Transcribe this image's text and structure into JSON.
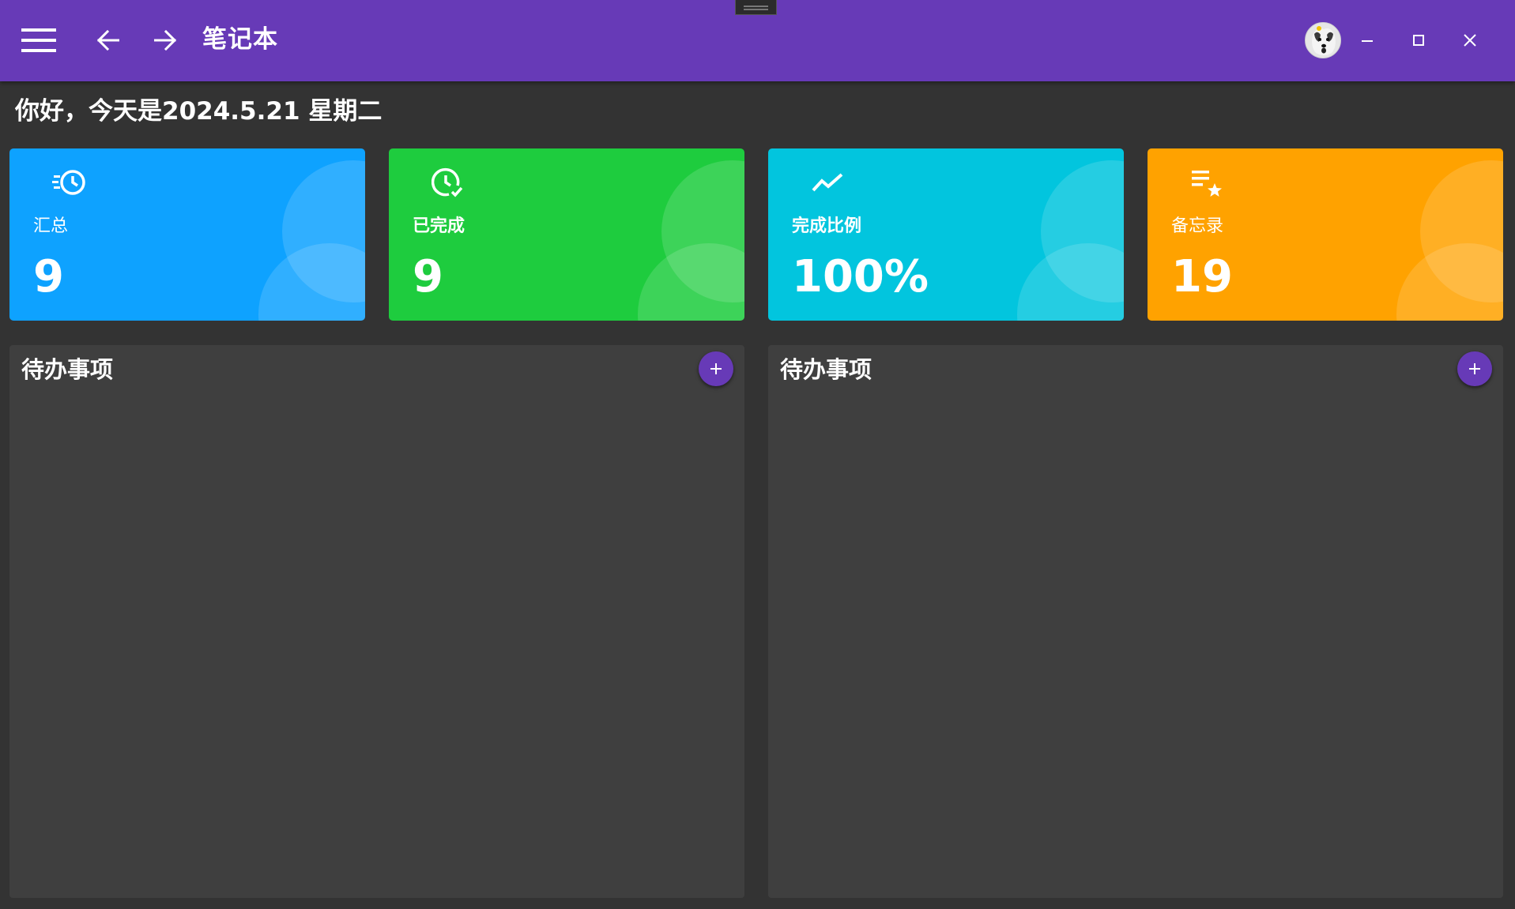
{
  "app": {
    "title": "笔记本",
    "icons": {
      "menu": "menu-icon",
      "back": "arrow-left-icon",
      "forward": "arrow-right-icon",
      "avatar": "user-avatar",
      "minimize": "minimize-icon",
      "maximize": "maximize-icon",
      "close": "close-icon"
    },
    "colors": {
      "appbar": "#673ab7",
      "background": "#333333",
      "panel": "#3f3f3f"
    }
  },
  "greeting": "你好，今天是2024.5.21 星期二",
  "cards": [
    {
      "icon": "clock-fast-icon",
      "label": "汇总",
      "value": "9",
      "color": "#0ea2ff"
    },
    {
      "icon": "clock-check-icon",
      "label": "已完成",
      "value": "9",
      "color": "#1ecc3e"
    },
    {
      "icon": "chart-line-icon",
      "label": "完成比例",
      "value": "100%",
      "color": "#02c5de"
    },
    {
      "icon": "playlist-star-icon",
      "label": "备忘录",
      "value": "19",
      "color": "#ffa200"
    }
  ],
  "panels": [
    {
      "title": "待办事项",
      "add_icon": "plus-icon"
    },
    {
      "title": "待办事项",
      "add_icon": "plus-icon"
    }
  ]
}
